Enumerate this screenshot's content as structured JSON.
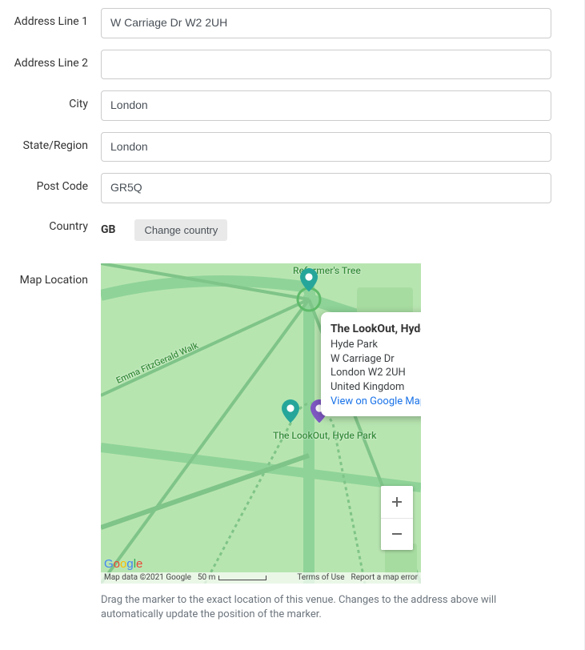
{
  "fields": {
    "address1": {
      "label": "Address Line 1",
      "value": "W Carriage Dr W2 2UH"
    },
    "address2": {
      "label": "Address Line 2",
      "value": ""
    },
    "city": {
      "label": "City",
      "value": "London"
    },
    "state": {
      "label": "State/Region",
      "value": "London"
    },
    "postcode": {
      "label": "Post Code",
      "value": "GR5Q"
    },
    "country": {
      "label": "Country",
      "code": "GB",
      "change_label": "Change country"
    },
    "map": {
      "label": "Map Location"
    }
  },
  "map": {
    "poi_top": "Reformer's Tree",
    "poi_mid": "The LookOut, Hyde Park",
    "road_label": "Emma FitzGerald Walk",
    "infowindow": {
      "title": "The LookOut, Hyde Park",
      "lines": [
        "Hyde Park",
        "W Carriage Dr",
        "London W2 2UH",
        "United Kingdom"
      ],
      "link": "View on Google Maps"
    },
    "footer": {
      "copyright": "Map data ©2021 Google",
      "scale": "50 m",
      "terms": "Terms of Use",
      "report": "Report a map error"
    },
    "hint": "Drag the marker to the exact location of this venue. Changes to the address above will automatically update the position of the marker."
  }
}
